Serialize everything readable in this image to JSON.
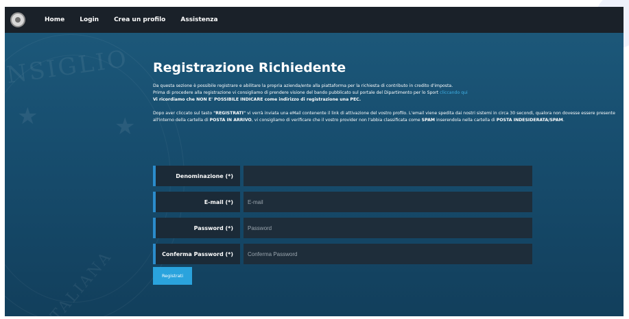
{
  "navbar": {
    "logo_icon": "republic-emblem-icon",
    "items": [
      {
        "label": "Home"
      },
      {
        "label": "Login"
      },
      {
        "label": "Crea un profilo"
      },
      {
        "label": "Assistenza"
      }
    ]
  },
  "background": {
    "watermark_top": "NSIGLIO",
    "watermark_bottom": "ITALIANA"
  },
  "main": {
    "title": "Registrazione Richiedente",
    "intro_line1": "Da questa sezione è possibile registrare e abilitare la propria azienda/ente alla piattaforma per la richiesta di contributo in credito d'imposta.",
    "intro_line2": "Prima di procedere alla registrazione vi consigliamo di prendere visione del bando pubblicato sul portale del Dipartimento per lo Sport ",
    "intro_link": "cliccando qui",
    "warning": "Vi ricordiamo che NON E' POSSIBILE INDICARE come indirizzo di registrazione una PEC.",
    "info": {
      "t1": "Dopo aver cliccato sul tasto ",
      "b1": "\"REGISTRATI\"",
      "t2": " vi verrà inviata una eMail contenente il link di attivazione del vostro profilo. L'email viene spedita dai nostri sistemi in circa 30 secondi, qualora non dovesse essere presente all'interno della cartella di ",
      "b2": "POSTA IN ARRIVO",
      "t3": ", vi consigliamo di verificare che il vostro provider non l'abbia classificata come ",
      "b3": "SPAM",
      "t4": " inserendola nella cartella di ",
      "b4": "POSTA INDESIDERATA/SPAM",
      "t5": "."
    }
  },
  "form": {
    "denominazione": {
      "label": "Denominazione (*)",
      "placeholder": "",
      "value": ""
    },
    "email": {
      "label": "E-mail (*)",
      "placeholder": "E-mail",
      "value": ""
    },
    "password": {
      "label": "Password (*)",
      "placeholder": "Password",
      "value": ""
    },
    "confirm": {
      "label": "Conferma Password (*)",
      "placeholder": "Conferma Password",
      "value": ""
    },
    "submit_label": "Registrati"
  },
  "colors": {
    "navbar_bg": "#1a2129",
    "page_bg": "#1d5a7c",
    "accent": "#2aa3dd",
    "link": "#3fb1e6",
    "label_bar": "#2b8ccc"
  }
}
